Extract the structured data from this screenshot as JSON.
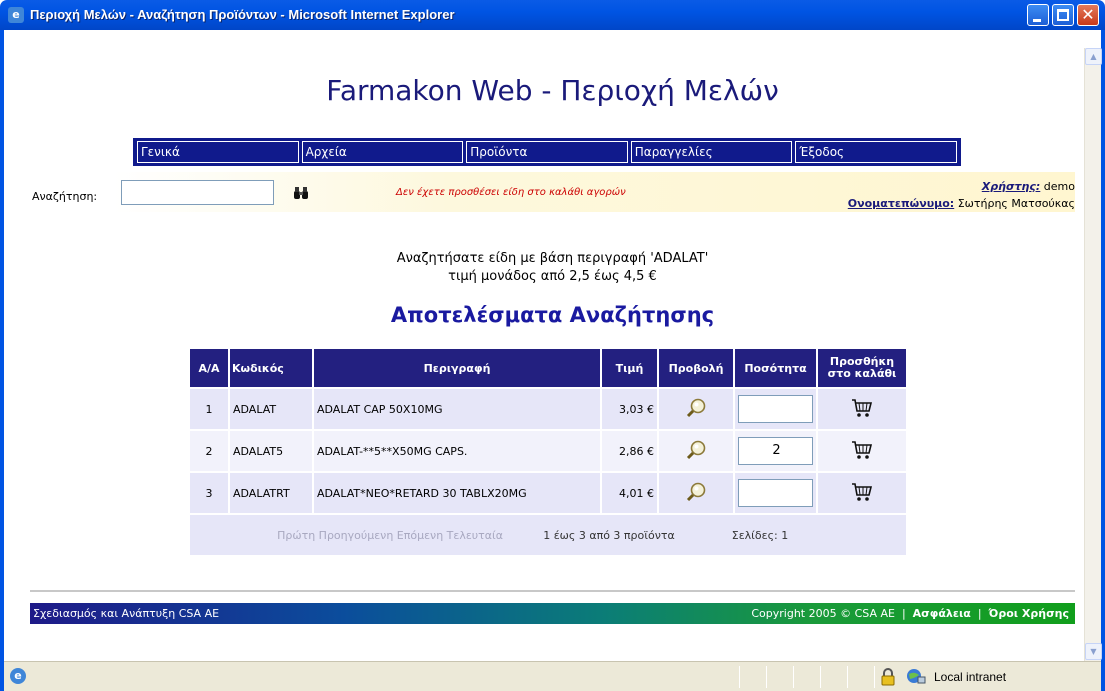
{
  "window": {
    "title": "Περιοχή Μελών - Αναζήτηση Προϊόντων - Microsoft Internet Explorer"
  },
  "page": {
    "title": "Farmakon Web - Περιοχή Μελών"
  },
  "menu": {
    "items": [
      "Γενικά",
      "Αρχεία",
      "Προϊόντα",
      "Παραγγελίες",
      "Έξοδος"
    ]
  },
  "search": {
    "label": "Αναζήτηση:",
    "value": "",
    "cart_message": "Δεν έχετε προσθέσει είδη στο καλάθι αγορών"
  },
  "user": {
    "user_label": "Χρήστης:",
    "user_value": "demo",
    "name_label": "Ονοματεπώνυμο:",
    "name_value": "Σωτήρης Ματσούκας"
  },
  "search_summary": {
    "line1": "Αναζητήσατε είδη με βάση περιγραφή 'ADALAT'",
    "line2": "τιμή μονάδος από 2,5 έως 4,5 €"
  },
  "results": {
    "title": "Αποτελέσματα Αναζήτησης",
    "headers": [
      "Α/Α",
      "Κωδικός",
      "Περιγραφή",
      "Τιμή",
      "Προβολή",
      "Ποσότητα",
      "Προσθήκη στο καλάθι"
    ],
    "rows": [
      {
        "aa": "1",
        "code": "ADALAT",
        "description": "ADALAT CAP 50X10MG",
        "price": "3,03 €",
        "quantity": ""
      },
      {
        "aa": "2",
        "code": "ADALAT5",
        "description": "ADALAT-**5**X50MG CAPS.",
        "price": "2,86 €",
        "quantity": "2"
      },
      {
        "aa": "3",
        "code": "ADALATRT",
        "description": "ADALAT*NEO*RETARD 30 TABLX20MG",
        "price": "4,01 €",
        "quantity": ""
      }
    ],
    "pager": {
      "links": "Πρώτη Προηγούμενη Επόμενη Τελευταία",
      "range": "1 έως 3 από 3 προϊόντα",
      "pages": "Σελίδες: 1"
    }
  },
  "footer": {
    "left": "Σχεδιασμός και Ανάπτυξη CSA AE",
    "copyright": "Copyright 2005 © CSA AE",
    "security": "Ασφάλεια",
    "terms": "Όροι Χρήσης"
  },
  "statusbar": {
    "zone": "Local intranet"
  },
  "colors": {
    "titlebar": "#0054e3",
    "menubar": "#101a8c",
    "table_header": "#232080",
    "results_title": "#1a1aa0",
    "cart_message": "#cc0000"
  }
}
